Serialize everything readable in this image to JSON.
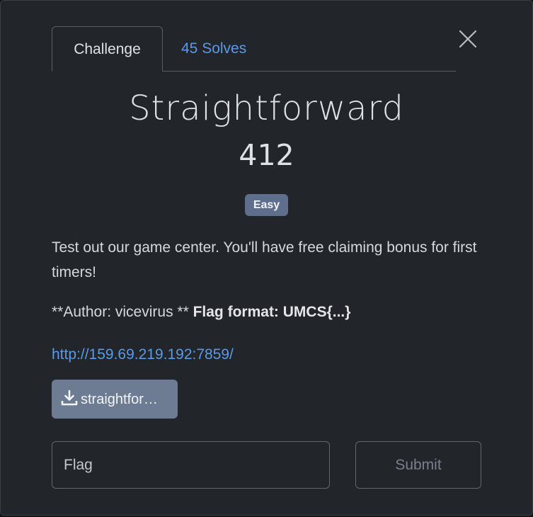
{
  "tabs": [
    {
      "label": "Challenge",
      "active": true
    },
    {
      "label": "45 Solves",
      "active": false
    }
  ],
  "challenge": {
    "name": "Straightforward",
    "points": "412",
    "difficulty": "Easy",
    "description": "Test out our game center. You'll have free claiming bonus for first timers!",
    "author_text": "**Author: vicevirus ** ",
    "flag_format_text": "Flag format: UMCS{...}",
    "url": "http://159.69.219.192:7859/",
    "file_label": "straightfor…"
  },
  "form": {
    "flag_placeholder": "Flag",
    "submit_label": "Submit"
  },
  "icons": {
    "close": "close-icon",
    "download": "download-icon"
  },
  "colors": {
    "background": "#22252a",
    "link": "#5b9ae6",
    "badge": "#5e6e8c",
    "file_button": "#6d7b93"
  }
}
